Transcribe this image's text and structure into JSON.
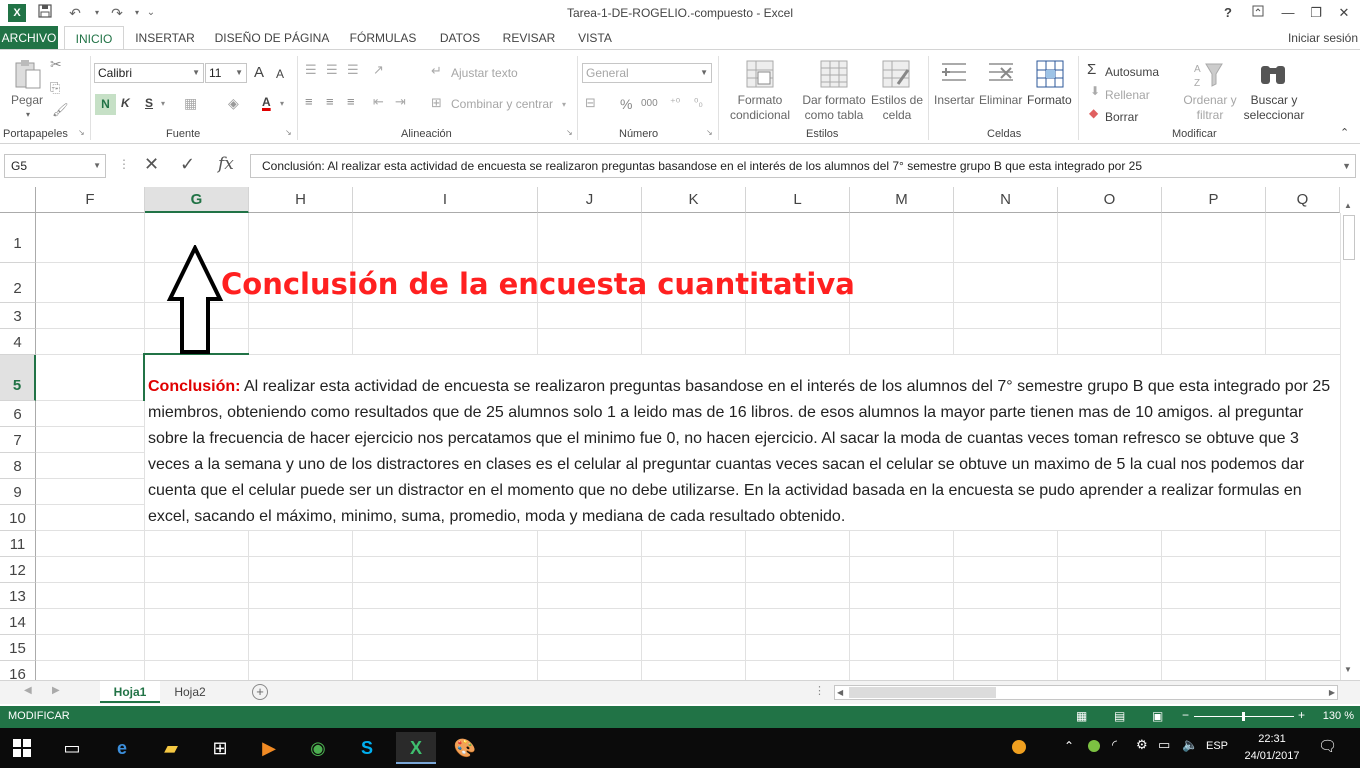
{
  "window": {
    "title": "Tarea-1-DE-ROGELIO.-compuesto - Excel",
    "app_badge": "X",
    "help": "?",
    "sign_in": "Iniciar sesión"
  },
  "tabs": [
    "ARCHIVO",
    "INICIO",
    "INSERTAR",
    "DISEÑO DE PÁGINA",
    "FÓRMULAS",
    "DATOS",
    "REVISAR",
    "VISTA"
  ],
  "ribbon": {
    "clipboard": {
      "paste": "Pegar",
      "group": "Portapapeles"
    },
    "font": {
      "name": "Calibri",
      "size": "11",
      "bold": "N",
      "italic": "K",
      "underline": "S",
      "grow": "A",
      "shrink": "A",
      "group": "Fuente"
    },
    "alignment": {
      "wrap": "Ajustar texto",
      "merge": "Combinar y centrar",
      "group": "Alineación"
    },
    "number": {
      "format": "General",
      "percent": "%",
      "thousands": "000",
      "group": "Número"
    },
    "styles": {
      "conditional": "Formato condicional",
      "table": "Dar formato como tabla",
      "cell": "Estilos de celda",
      "group": "Estilos"
    },
    "cells": {
      "insert": "Insertar",
      "delete": "Eliminar",
      "format": "Formato",
      "group": "Celdas"
    },
    "editing": {
      "autosum": "Autosuma",
      "fill": "Rellenar",
      "clear": "Borrar",
      "sort": "Ordenar y filtrar",
      "find": "Buscar y seleccionar",
      "group": "Modificar"
    }
  },
  "formula_bar": {
    "name_box": "G5",
    "fx": "fx",
    "content": "Conclusión: Al realizar esta actividad  de encuesta se realizaron preguntas basandose en el  interés de los alumnos del 7° semestre grupo B que esta integrado por 25"
  },
  "grid": {
    "columns": [
      "F",
      "G",
      "H",
      "I",
      "J",
      "K",
      "L",
      "M",
      "N",
      "O",
      "P",
      "Q"
    ],
    "selected_column": "G",
    "rows": [
      "1",
      "2",
      "3",
      "4",
      "5",
      "6",
      "7",
      "8",
      "9",
      "10",
      "11",
      "12",
      "13",
      "14",
      "15",
      "16"
    ],
    "selected_row": "5"
  },
  "sheet": {
    "heading": "Conclusión de la encuesta cuantitativa",
    "conclusion_label": "Conclusión:",
    "conclusion_text": " Al realizar esta actividad  de encuesta se realizaron preguntas basandose en el  interés de los alumnos del 7° semestre grupo B que esta integrado por 25 miembros, obteniendo como resultados que de 25 alumnos solo 1 a leido mas de 16 libros.  de esos alumnos la mayor parte tienen mas de 10 amigos. al preguntar sobre la frecuencia de hacer ejercicio nos percatamos que el minimo fue 0, no hacen ejercicio. Al sacar la moda de cuantas veces toman refresco se obtuve que 3 veces a la semana y uno de los distractores en clases es el celular al preguntar cuantas veces sacan el celular  se obtuve un maximo de 5 la cual nos podemos dar cuenta que el celular puede ser un distractor en el momento que no debe utilizarse. En la actividad basada en la encuesta se pudo aprender a realizar formulas en excel, sacando el máximo, minimo, suma, promedio, moda y mediana de cada resultado obtenido."
  },
  "sheet_tabs": {
    "tabs": [
      "Hoja1",
      "Hoja2"
    ],
    "active": "Hoja1",
    "add": "+"
  },
  "status_bar": {
    "mode": "MODIFICAR",
    "zoom": "130 %"
  },
  "taskbar": {
    "language": "ESP",
    "time": "22:31",
    "date": "24/01/2017"
  },
  "colors": {
    "excel_green": "#217346",
    "heading_red": "#ff2020",
    "label_red": "#e00000"
  }
}
